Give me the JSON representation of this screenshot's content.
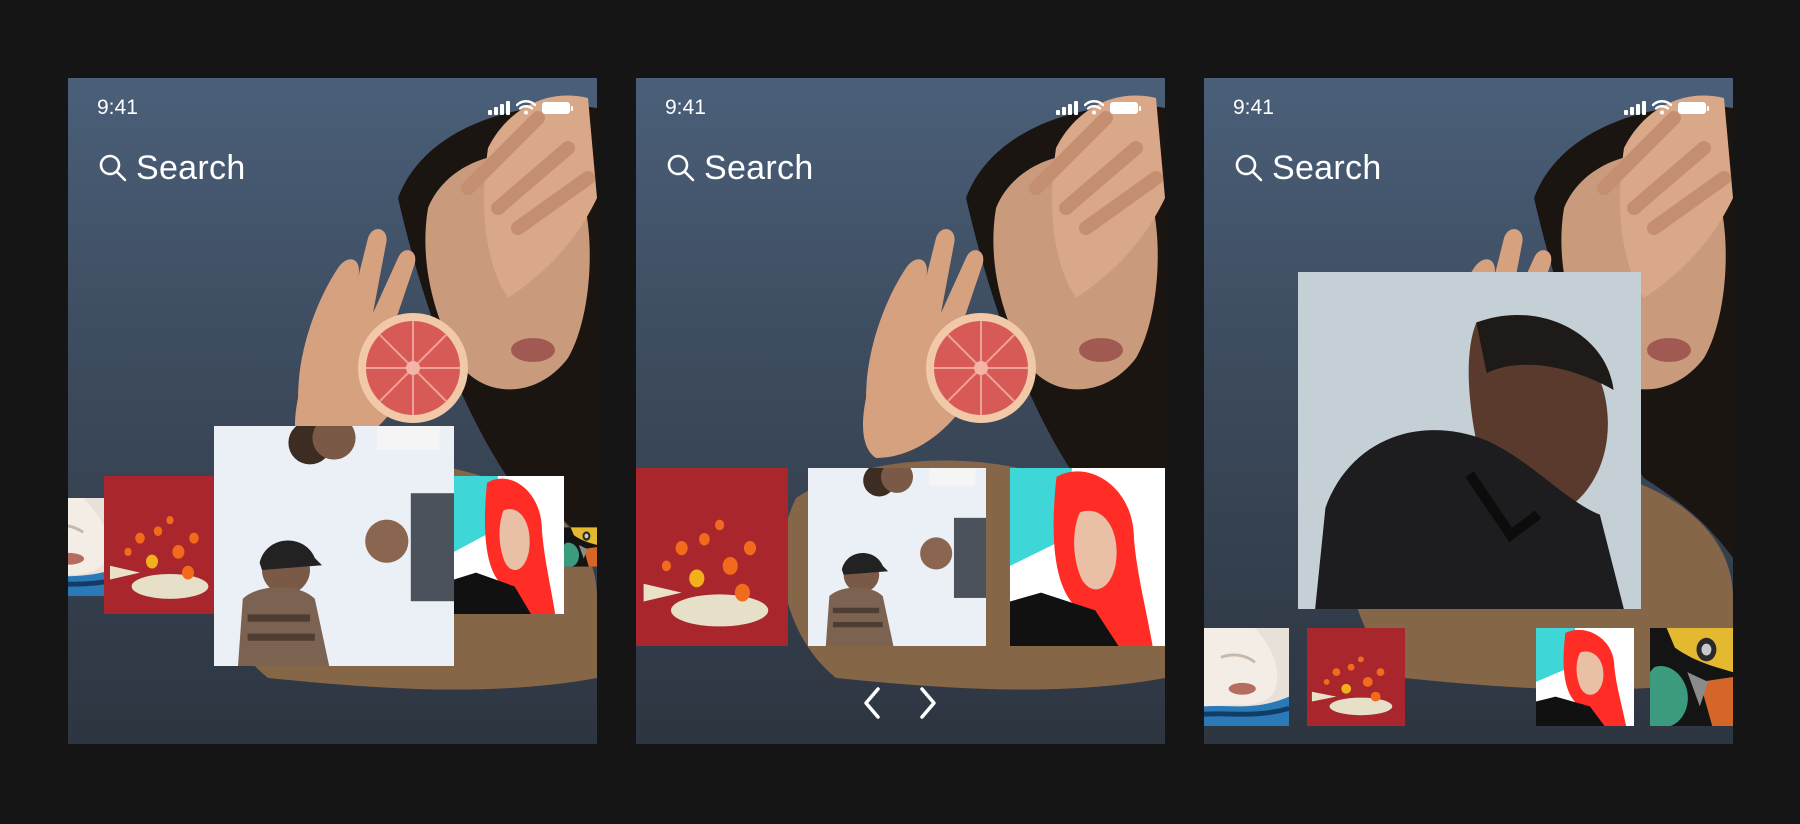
{
  "screens": [
    {
      "status_time": "9:41",
      "search_label": "Search"
    },
    {
      "status_time": "9:41",
      "search_label": "Search"
    },
    {
      "status_time": "9:41",
      "search_label": "Search"
    }
  ],
  "icons": {
    "search": "search-icon",
    "signal": "cellular-signal-icon",
    "wifi": "wifi-icon",
    "battery": "battery-icon",
    "prev": "chevron-left-icon",
    "next": "chevron-right-icon"
  },
  "colors": {
    "page_background": "#151515",
    "screen_gradient_top": "#4a5f79",
    "screen_gradient_bottom": "#2d3540",
    "text": "#ffffff"
  }
}
